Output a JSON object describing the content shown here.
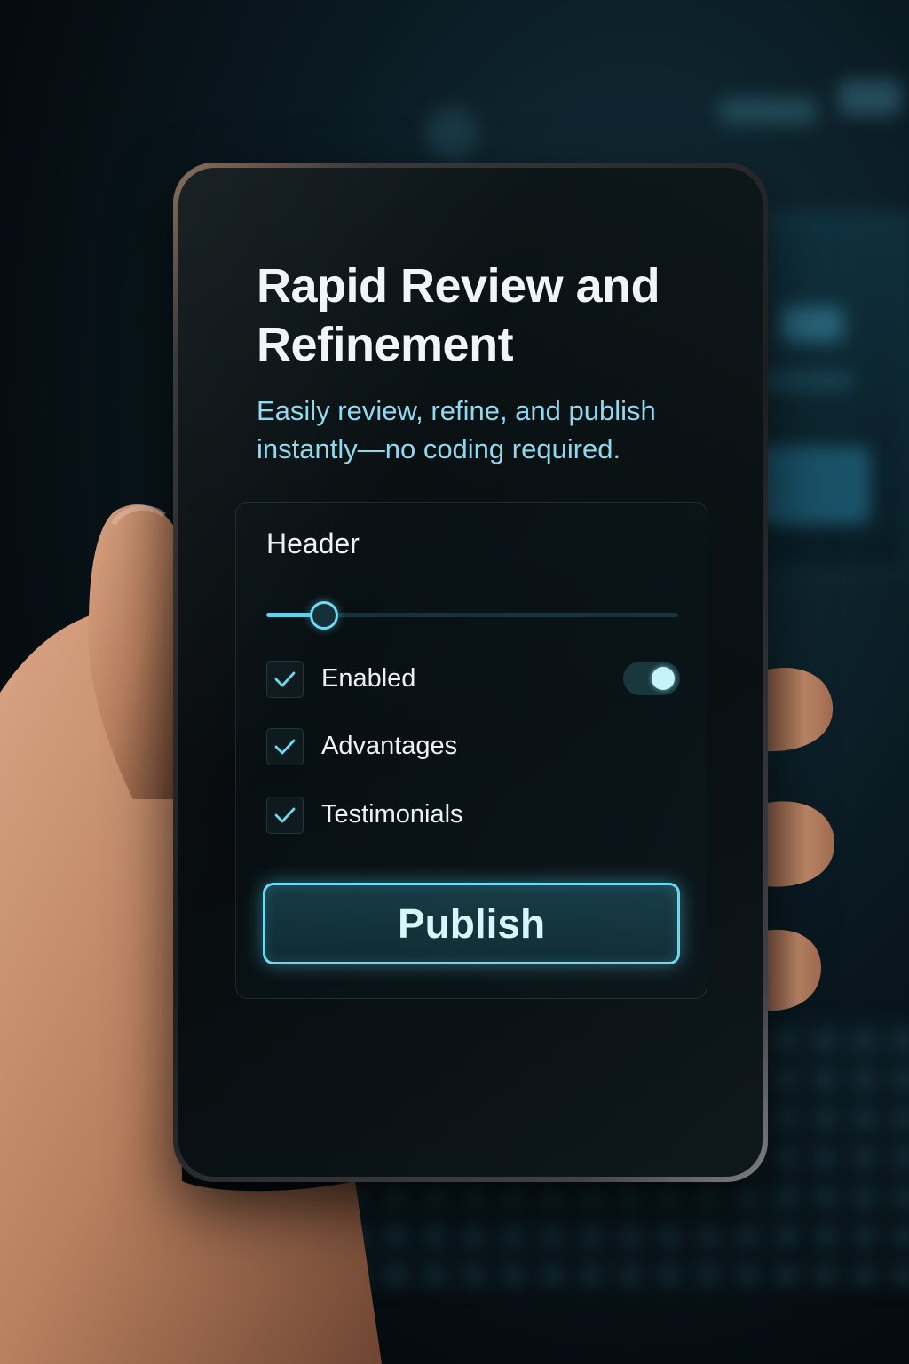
{
  "card": {
    "title": "Rapid Review and Refinement",
    "subtitle": "Easily review, refine, and publish instantly—no coding required."
  },
  "panel": {
    "title": "Header",
    "slider_value": 0.14,
    "options": [
      {
        "label": "Enabled",
        "checked": true,
        "toggle_on": true
      },
      {
        "label": "Advantages",
        "checked": true
      },
      {
        "label": "Testimonials",
        "checked": true
      }
    ],
    "publish_label": "Publish"
  },
  "icons": {
    "checkbox": "checkmark-icon"
  },
  "colors": {
    "accent": "#6ad9f1",
    "subtitle_text": "#8fd9ee",
    "title_text": "#f2f5f7",
    "screen_bg": "#070b0d"
  }
}
